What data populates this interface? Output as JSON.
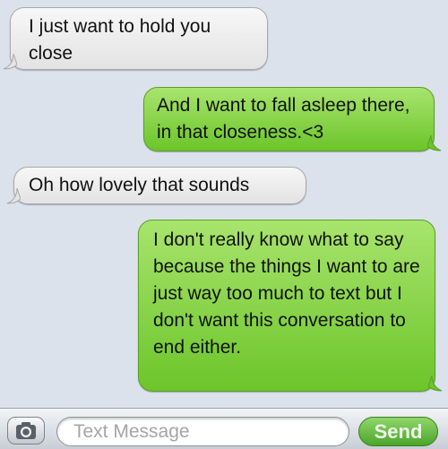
{
  "messages": [
    {
      "direction": "received",
      "text": "I just want to hold you close"
    },
    {
      "direction": "sent",
      "text": "And I want to fall asleep there, in that closeness.<3"
    },
    {
      "direction": "received",
      "text": "Oh how lovely that sounds"
    },
    {
      "direction": "sent",
      "text": "I don't really know what to say because the things I want to are just way too much to text but I don't want this conversation to end either."
    }
  ],
  "composer": {
    "camera_icon": "camera-icon",
    "placeholder": "Text Message",
    "value": "",
    "send_label": "Send"
  },
  "colors": {
    "background": "#dbe2ec",
    "received_bubble": "#ececec",
    "sent_bubble": "#8fd656",
    "send_button": "#5fb83a"
  }
}
